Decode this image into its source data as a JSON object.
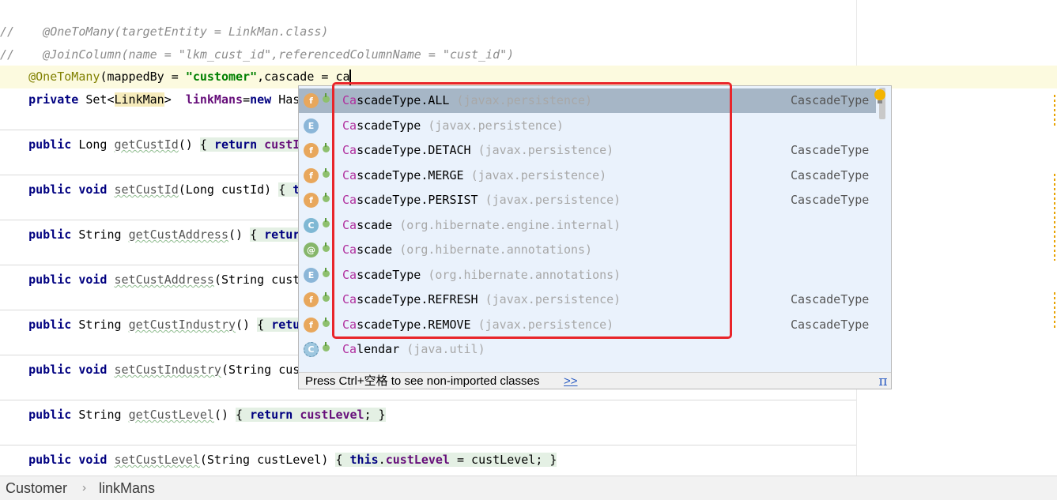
{
  "editor": {
    "comment1": "//    @OneToMany(targetEntity = LinkMan.class)",
    "comment2": "//    @JoinColumn(name = \"lkm_cust_id\",referencedColumnName = \"cust_id\")",
    "ann_line": {
      "ann": "@OneToMany",
      "args1": "(mappedBy = ",
      "str": "\"customer\"",
      "args2": ",cascade = ca"
    },
    "field_line": {
      "kw": "private",
      "type1": " Set<",
      "generic": "LinkMan",
      "type2": ">  ",
      "name": "linkMans",
      "rest": "=",
      "kw2": "new",
      "tail": " Has"
    },
    "methods": [
      {
        "kw": "public",
        "ret": " Long ",
        "name": "getCustId",
        "sig": "() ",
        "body_kw": "return",
        "body": " custI"
      },
      {
        "kw": "public",
        "kw2": "void",
        "name": "setCustId",
        "sig": "(Long custId) ",
        "body_kw": "t",
        "body": ""
      },
      {
        "kw": "public",
        "ret": " String ",
        "name": "getCustAddress",
        "sig": "() ",
        "body_kw": "retur",
        "body": ""
      },
      {
        "kw": "public",
        "kw2": "void",
        "name": "setCustAddress",
        "sig": "(String cust",
        "body_kw": "",
        "body": ""
      },
      {
        "kw": "public",
        "ret": " String ",
        "name": "getCustIndustry",
        "sig": "() ",
        "body_kw": "retu",
        "body": ""
      },
      {
        "kw": "public",
        "kw2": "void",
        "name": "setCustIndustry",
        "sig": "(String cus",
        "body_kw": "",
        "body": ""
      },
      {
        "kw": "public",
        "ret": " String ",
        "name": "getCustLevel",
        "sig": "() ",
        "body_kw": "return",
        "body": " ",
        "fld": "custLevel",
        "end": "; }"
      },
      {
        "kw": "public",
        "kw2": "void",
        "name": "setCustLevel",
        "sig": "(String custLevel) ",
        "body_kw": "this",
        "body": ".",
        "fld": "custLevel",
        "end": " = custLevel; }"
      }
    ]
  },
  "completion": {
    "items": [
      {
        "icon": "field-icon",
        "glyph": "f",
        "prefix": "Ca",
        "rest": "scadeType.ALL",
        "pkg": "(javax.persistence)",
        "type": "CascadeType"
      },
      {
        "icon": "enum-icon",
        "glyph": "E",
        "prefix": "Ca",
        "rest": "scadeType",
        "pkg": "(javax.persistence)",
        "type": ""
      },
      {
        "icon": "field-icon",
        "glyph": "f",
        "prefix": "Ca",
        "rest": "scadeType.DETACH",
        "pkg": "(javax.persistence)",
        "type": "CascadeType"
      },
      {
        "icon": "field-icon",
        "glyph": "f",
        "prefix": "Ca",
        "rest": "scadeType.MERGE",
        "pkg": "(javax.persistence)",
        "type": "CascadeType"
      },
      {
        "icon": "field-icon",
        "glyph": "f",
        "prefix": "Ca",
        "rest": "scadeType.PERSIST",
        "pkg": "(javax.persistence)",
        "type": "CascadeType"
      },
      {
        "icon": "class-icon",
        "glyph": "C",
        "prefix": "Ca",
        "rest": "scade",
        "pkg": "(org.hibernate.engine.internal)",
        "type": ""
      },
      {
        "icon": "annotation-icon",
        "glyph": "@",
        "prefix": "Ca",
        "rest": "scade",
        "pkg": "(org.hibernate.annotations)",
        "type": ""
      },
      {
        "icon": "enum-icon",
        "glyph": "E",
        "prefix": "Ca",
        "rest": "scadeType",
        "pkg": "(org.hibernate.annotations)",
        "type": ""
      },
      {
        "icon": "field-icon",
        "glyph": "f",
        "prefix": "Ca",
        "rest": "scadeType.REFRESH",
        "pkg": "(javax.persistence)",
        "type": "CascadeType"
      },
      {
        "icon": "field-icon",
        "glyph": "f",
        "prefix": "Ca",
        "rest": "scadeType.REMOVE",
        "pkg": "(javax.persistence)",
        "type": "CascadeType"
      },
      {
        "icon": "abstract-class-icon",
        "glyph": "C",
        "prefix": "Ca",
        "rest": "lendar",
        "pkg": "(java.util)",
        "type": ""
      }
    ],
    "footer_hint": "Press Ctrl+空格 to see non-imported classes",
    "footer_link": ">>",
    "pi_glyph": "π"
  },
  "breadcrumb": {
    "class": "Customer",
    "separator": "›",
    "member": "linkMans"
  }
}
